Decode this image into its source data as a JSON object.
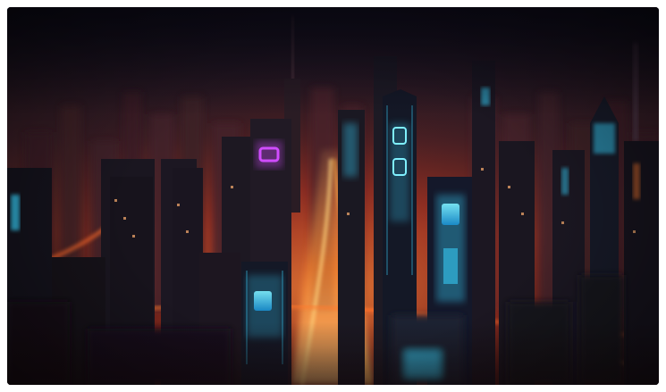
{
  "image": {
    "subject": "neon-city-scene",
    "colors": {
      "sky_top": "#14121f",
      "haze": "#7a2f2a",
      "glow_orange": "#ff7a2e",
      "glow_red": "#e23b24",
      "neon_cyan": "#39d4ff",
      "neon_magenta": "#d04dff",
      "building_dark": "#15131d",
      "building_mid": "#231c26"
    }
  }
}
